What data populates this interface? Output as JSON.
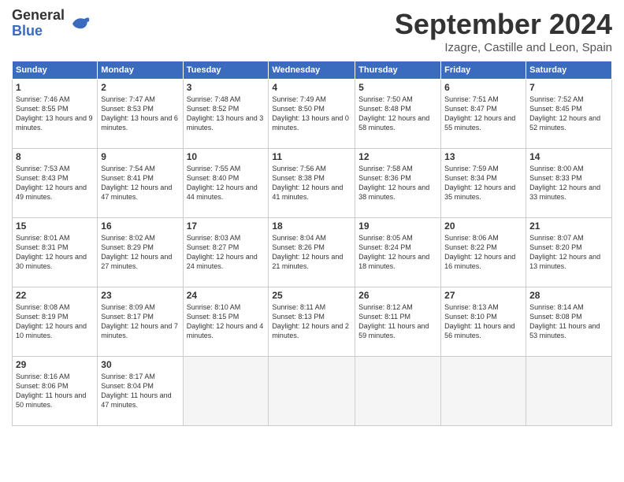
{
  "header": {
    "logo_line1": "General",
    "logo_line2": "Blue",
    "month_title": "September 2024",
    "location": "Izagre, Castille and Leon, Spain"
  },
  "weekdays": [
    "Sunday",
    "Monday",
    "Tuesday",
    "Wednesday",
    "Thursday",
    "Friday",
    "Saturday"
  ],
  "weeks": [
    [
      {
        "day": "1",
        "sunrise": "7:46 AM",
        "sunset": "8:55 PM",
        "daylight": "13 hours and 9 minutes."
      },
      {
        "day": "2",
        "sunrise": "7:47 AM",
        "sunset": "8:53 PM",
        "daylight": "13 hours and 6 minutes."
      },
      {
        "day": "3",
        "sunrise": "7:48 AM",
        "sunset": "8:52 PM",
        "daylight": "13 hours and 3 minutes."
      },
      {
        "day": "4",
        "sunrise": "7:49 AM",
        "sunset": "8:50 PM",
        "daylight": "13 hours and 0 minutes."
      },
      {
        "day": "5",
        "sunrise": "7:50 AM",
        "sunset": "8:48 PM",
        "daylight": "12 hours and 58 minutes."
      },
      {
        "day": "6",
        "sunrise": "7:51 AM",
        "sunset": "8:47 PM",
        "daylight": "12 hours and 55 minutes."
      },
      {
        "day": "7",
        "sunrise": "7:52 AM",
        "sunset": "8:45 PM",
        "daylight": "12 hours and 52 minutes."
      }
    ],
    [
      {
        "day": "8",
        "sunrise": "7:53 AM",
        "sunset": "8:43 PM",
        "daylight": "12 hours and 49 minutes."
      },
      {
        "day": "9",
        "sunrise": "7:54 AM",
        "sunset": "8:41 PM",
        "daylight": "12 hours and 47 minutes."
      },
      {
        "day": "10",
        "sunrise": "7:55 AM",
        "sunset": "8:40 PM",
        "daylight": "12 hours and 44 minutes."
      },
      {
        "day": "11",
        "sunrise": "7:56 AM",
        "sunset": "8:38 PM",
        "daylight": "12 hours and 41 minutes."
      },
      {
        "day": "12",
        "sunrise": "7:58 AM",
        "sunset": "8:36 PM",
        "daylight": "12 hours and 38 minutes."
      },
      {
        "day": "13",
        "sunrise": "7:59 AM",
        "sunset": "8:34 PM",
        "daylight": "12 hours and 35 minutes."
      },
      {
        "day": "14",
        "sunrise": "8:00 AM",
        "sunset": "8:33 PM",
        "daylight": "12 hours and 33 minutes."
      }
    ],
    [
      {
        "day": "15",
        "sunrise": "8:01 AM",
        "sunset": "8:31 PM",
        "daylight": "12 hours and 30 minutes."
      },
      {
        "day": "16",
        "sunrise": "8:02 AM",
        "sunset": "8:29 PM",
        "daylight": "12 hours and 27 minutes."
      },
      {
        "day": "17",
        "sunrise": "8:03 AM",
        "sunset": "8:27 PM",
        "daylight": "12 hours and 24 minutes."
      },
      {
        "day": "18",
        "sunrise": "8:04 AM",
        "sunset": "8:26 PM",
        "daylight": "12 hours and 21 minutes."
      },
      {
        "day": "19",
        "sunrise": "8:05 AM",
        "sunset": "8:24 PM",
        "daylight": "12 hours and 18 minutes."
      },
      {
        "day": "20",
        "sunrise": "8:06 AM",
        "sunset": "8:22 PM",
        "daylight": "12 hours and 16 minutes."
      },
      {
        "day": "21",
        "sunrise": "8:07 AM",
        "sunset": "8:20 PM",
        "daylight": "12 hours and 13 minutes."
      }
    ],
    [
      {
        "day": "22",
        "sunrise": "8:08 AM",
        "sunset": "8:19 PM",
        "daylight": "12 hours and 10 minutes."
      },
      {
        "day": "23",
        "sunrise": "8:09 AM",
        "sunset": "8:17 PM",
        "daylight": "12 hours and 7 minutes."
      },
      {
        "day": "24",
        "sunrise": "8:10 AM",
        "sunset": "8:15 PM",
        "daylight": "12 hours and 4 minutes."
      },
      {
        "day": "25",
        "sunrise": "8:11 AM",
        "sunset": "8:13 PM",
        "daylight": "12 hours and 2 minutes."
      },
      {
        "day": "26",
        "sunrise": "8:12 AM",
        "sunset": "8:11 PM",
        "daylight": "11 hours and 59 minutes."
      },
      {
        "day": "27",
        "sunrise": "8:13 AM",
        "sunset": "8:10 PM",
        "daylight": "11 hours and 56 minutes."
      },
      {
        "day": "28",
        "sunrise": "8:14 AM",
        "sunset": "8:08 PM",
        "daylight": "11 hours and 53 minutes."
      }
    ],
    [
      {
        "day": "29",
        "sunrise": "8:16 AM",
        "sunset": "8:06 PM",
        "daylight": "11 hours and 50 minutes."
      },
      {
        "day": "30",
        "sunrise": "8:17 AM",
        "sunset": "8:04 PM",
        "daylight": "11 hours and 47 minutes."
      },
      null,
      null,
      null,
      null,
      null
    ]
  ]
}
